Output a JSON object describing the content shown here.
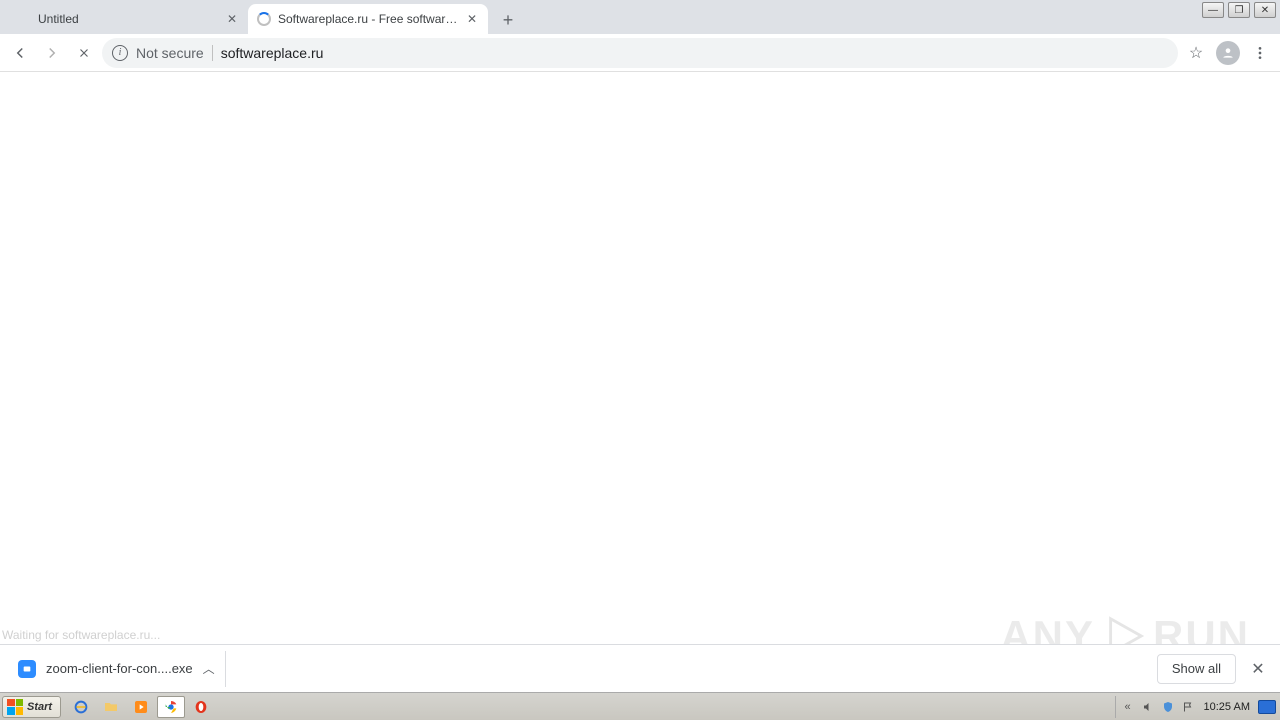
{
  "tabs": [
    {
      "title": "Untitled",
      "active": false
    },
    {
      "title": "Softwareplace.ru - Free software ca",
      "active": true,
      "loading": true
    }
  ],
  "toolbar": {
    "security_label": "Not secure",
    "url": "softwareplace.ru"
  },
  "status": {
    "text": "Waiting for softwareplace.ru..."
  },
  "downloads": {
    "item_filename": "zoom-client-for-con....exe",
    "show_all_label": "Show all"
  },
  "taskbar": {
    "start_label": "Start",
    "clock": "10:25 AM"
  },
  "watermark": {
    "left": "ANY",
    "right": "RUN"
  }
}
